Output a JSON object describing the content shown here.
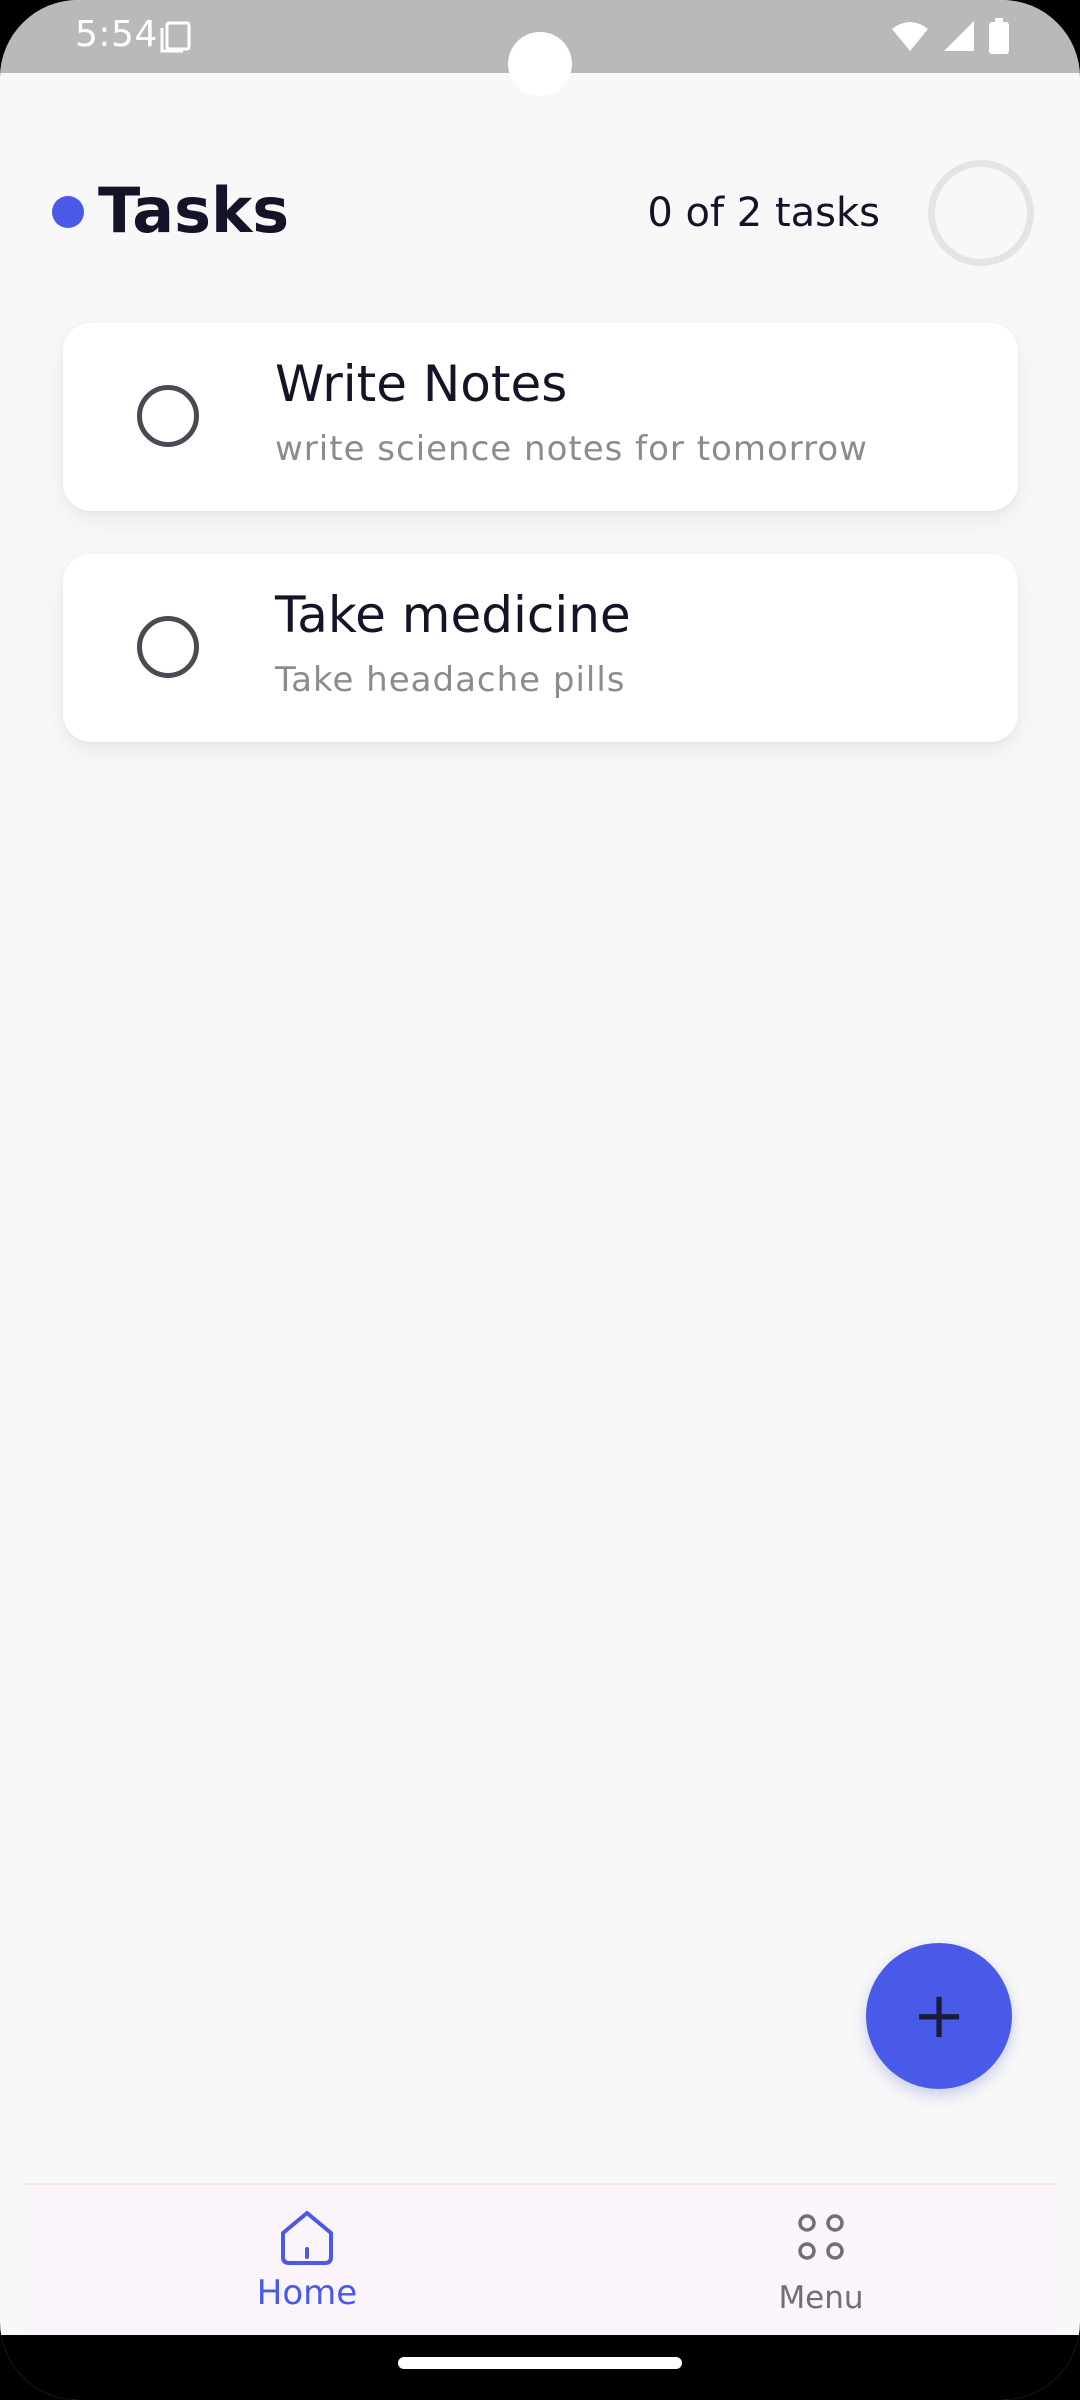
{
  "status_bar": {
    "time": "5:54",
    "icons": [
      "sim-card-icon",
      "wifi-icon",
      "signal-icon",
      "battery-icon"
    ]
  },
  "header": {
    "title": "Tasks",
    "count_text": "0 of 2 tasks",
    "progress_fraction": 0
  },
  "tasks": [
    {
      "title": "Write Notes",
      "description": "write science notes for tomorrow",
      "completed": false
    },
    {
      "title": "Take medicine",
      "description": "Take headache pills",
      "completed": false
    }
  ],
  "fab": {
    "icon": "plus-icon",
    "symbol": "+"
  },
  "bottom_nav": {
    "items": [
      {
        "label": "Home",
        "icon": "home-icon",
        "active": true
      },
      {
        "label": "Menu",
        "icon": "menu-dots-icon",
        "active": false
      }
    ]
  },
  "colors": {
    "accent": "#4a5ae8",
    "background": "#f8f8f8",
    "text_primary": "#141428",
    "text_secondary": "#8c8c8c",
    "nav_background": "#fbf4fb"
  }
}
